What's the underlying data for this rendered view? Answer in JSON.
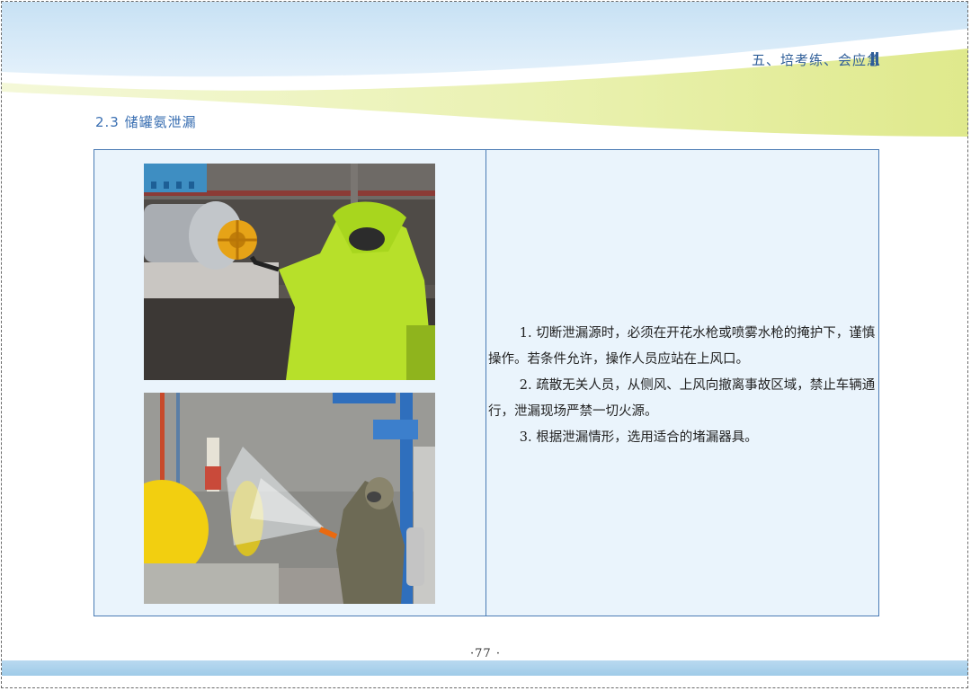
{
  "header": {
    "section": "五、培考练、会应急",
    "colors": {
      "band_top": "#cfe6f6",
      "band_wave": "#e6f0a8",
      "accent": "#2f5e98"
    }
  },
  "section_title": "2.3 储罐氨泄漏",
  "photos": [
    {
      "subject": "worker in yellow-green chemical protective suit operating a valve wheel on pipeline"
    },
    {
      "subject": "firefighter in protective suit spraying water mist at ammonia storage tank area"
    }
  ],
  "paragraphs": [
    "1. 切断泄漏源时，必须在开花水枪或喷雾水枪的掩护下，谨慎操作。若条件允许，操作人员应站在上风口。",
    "2. 疏散无关人员，从侧风、上风向撤离事故区域，禁止车辆通行，泄漏现场严禁一切火源。",
    "3. 根据泄漏情形，选用适合的堵漏器具。"
  ],
  "footer": {
    "page_number": "·77 ·"
  }
}
